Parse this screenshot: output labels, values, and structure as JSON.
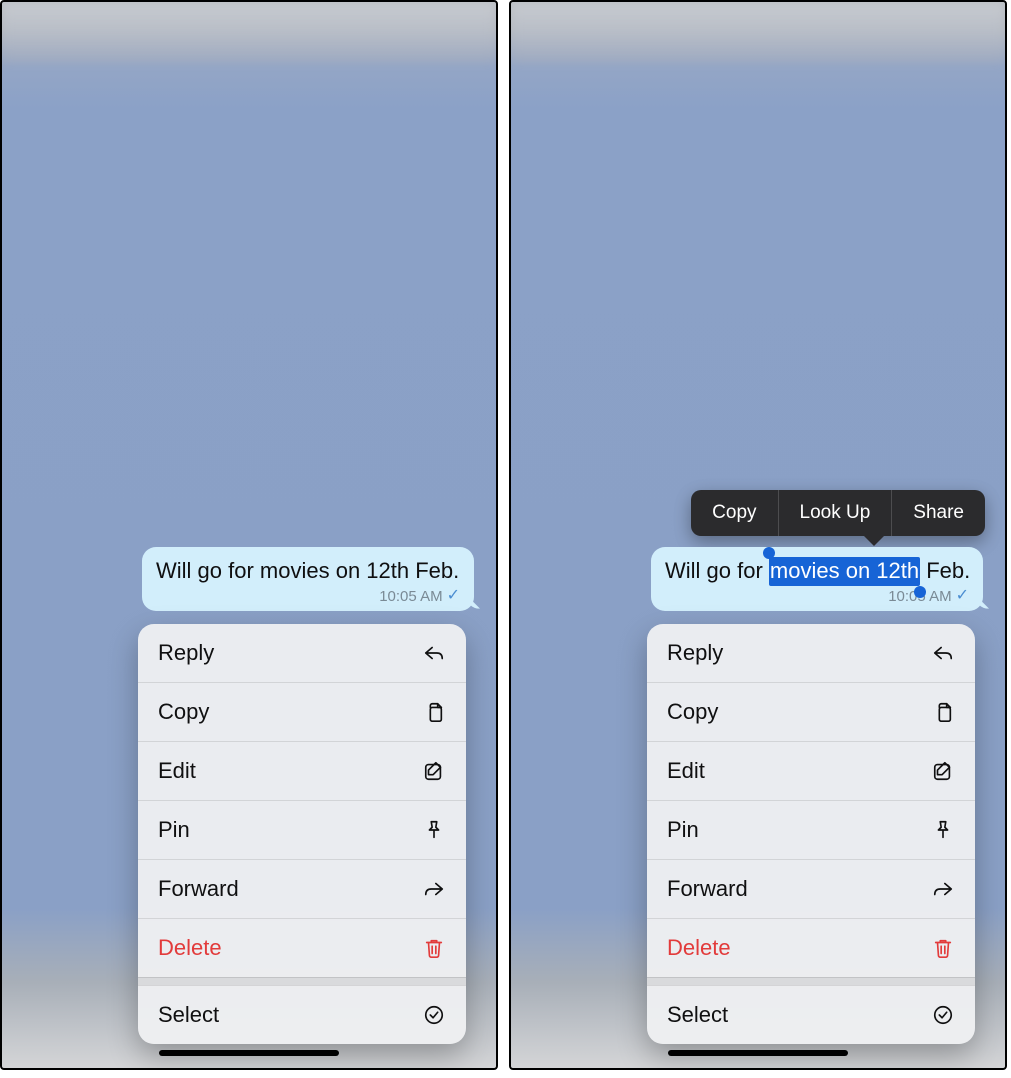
{
  "message": {
    "text_before": "Will go for ",
    "text_selected": "movies on 12th",
    "text_after": " Feb.",
    "full_text": "Will go for movies on 12th Feb.",
    "time": "10:05 AM",
    "time_right": "10:05 AM"
  },
  "menu": {
    "items": [
      {
        "label": "Reply",
        "icon": "reply-icon",
        "danger": false
      },
      {
        "label": "Copy",
        "icon": "copy-docs-icon",
        "danger": false
      },
      {
        "label": "Edit",
        "icon": "edit-icon",
        "danger": false
      },
      {
        "label": "Pin",
        "icon": "pin-icon",
        "danger": false
      },
      {
        "label": "Forward",
        "icon": "forward-icon",
        "danger": false
      },
      {
        "label": "Delete",
        "icon": "trash-icon",
        "danger": true
      }
    ],
    "select_label": "Select",
    "select_icon": "check-circle-icon"
  },
  "selection_popup": {
    "copy": "Copy",
    "lookup": "Look Up",
    "share": "Share"
  }
}
